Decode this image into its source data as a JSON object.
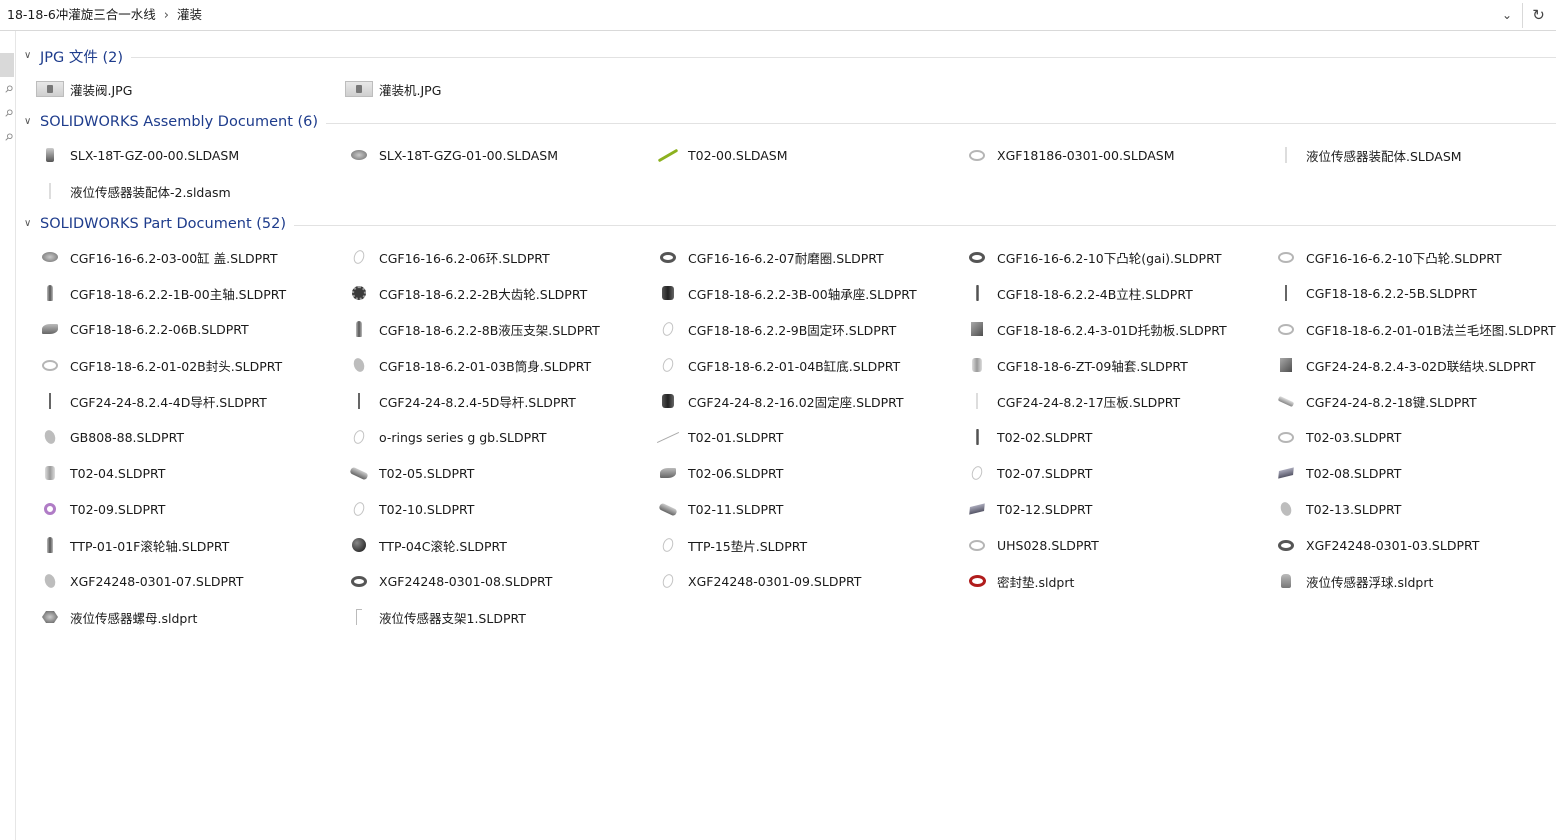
{
  "breadcrumb": [
    "18-18-6冲灌旋三合一水线",
    "灌装"
  ],
  "breadcrumb_separator": "›",
  "address_dropdown_icon": "chevron-down-icon",
  "refresh_icon": "refresh-icon",
  "groups": [
    {
      "title": "JPG 文件 (2)",
      "items": [
        {
          "name": "灌装阀.JPG",
          "icon": "thumb"
        },
        {
          "name": "灌装机.JPG",
          "icon": "thumb"
        }
      ]
    },
    {
      "title": "SOLIDWORKS Assembly Document (6)",
      "items": [
        {
          "name": "SLX-18T-GZ-00-00.SLDASM",
          "icon": "asm"
        },
        {
          "name": "SLX-18T-GZG-01-00.SLDASM",
          "icon": "disc"
        },
        {
          "name": "T02-00.SLDASM",
          "icon": "stick"
        },
        {
          "name": "XGF18186-0301-00.SLDASM",
          "icon": "ring-light"
        },
        {
          "name": "液位传感器装配体.SLDASM",
          "icon": "faint"
        },
        {
          "name": "液位传感器装配体-2.sldasm",
          "icon": "faint"
        }
      ]
    },
    {
      "title": "SOLIDWORKS Part Document (52)",
      "items": [
        {
          "name": "CGF16-16-6.2-03-00缸 盖.SLDPRT",
          "icon": "disc"
        },
        {
          "name": "CGF16-16-6.2-06环.SLDPRT",
          "icon": "ring-thin"
        },
        {
          "name": "CGF16-16-6.2-07耐磨圈.SLDPRT",
          "icon": "ring"
        },
        {
          "name": "CGF16-16-6.2-10下凸轮(gai).SLDPRT",
          "icon": "ring"
        },
        {
          "name": "CGF16-16-6.2-10下凸轮.SLDPRT",
          "icon": "ring-light"
        },
        {
          "name": "CGF18-18-6.2.2-1B-00主轴.SLDPRT",
          "icon": "pin2"
        },
        {
          "name": "CGF18-18-6.2.2-2B大齿轮.SLDPRT",
          "icon": "gear"
        },
        {
          "name": "CGF18-18-6.2.2-3B-00轴承座.SLDPRT",
          "icon": "cyl"
        },
        {
          "name": "CGF18-18-6.2.2-4B立柱.SLDPRT",
          "icon": "rod"
        },
        {
          "name": "CGF18-18-6.2.2-5B.SLDPRT",
          "icon": "rod-thin"
        },
        {
          "name": "CGF18-18-6.2.2-06B.SLDPRT",
          "icon": "mouse"
        },
        {
          "name": "CGF18-18-6.2.2-8B液压支架.SLDPRT",
          "icon": "pin2"
        },
        {
          "name": "CGF18-18-6.2.2-9B固定环.SLDPRT",
          "icon": "ring-thin"
        },
        {
          "name": "CGF18-18-6.2.4-3-01D托勃板.SLDPRT",
          "icon": "block"
        },
        {
          "name": "CGF18-18-6.2-01-01B法兰毛坯图.SLDPRT",
          "icon": "ring-light"
        },
        {
          "name": "CGF18-18-6.2-01-02B封头.SLDPRT",
          "icon": "ring-light"
        },
        {
          "name": "CGF18-18-6.2-01-03B筒身.SLDPRT",
          "icon": "oval"
        },
        {
          "name": "CGF18-18-6.2-01-04B缸底.SLDPRT",
          "icon": "ring-thin"
        },
        {
          "name": "CGF18-18-6-ZT-09轴套.SLDPRT",
          "icon": "cyl-light"
        },
        {
          "name": "CGF24-24-8.2.4-3-02D联结块.SLDPRT",
          "icon": "block"
        },
        {
          "name": "CGF24-24-8.2.4-4D导杆.SLDPRT",
          "icon": "rod-thin"
        },
        {
          "name": "CGF24-24-8.2.4-5D导杆.SLDPRT",
          "icon": "rod-thin"
        },
        {
          "name": "CGF24-24-8.2-16.02固定座.SLDPRT",
          "icon": "cyl"
        },
        {
          "name": "CGF24-24-8.2-17压板.SLDPRT",
          "icon": "faint"
        },
        {
          "name": "CGF24-24-8.2-18键.SLDPRT",
          "icon": "shaft"
        },
        {
          "name": "GB808-88.SLDPRT",
          "icon": "oval"
        },
        {
          "name": "o-rings series g gb.SLDPRT",
          "icon": "ring-thin"
        },
        {
          "name": "T02-01.SLDPRT",
          "icon": "line-diag"
        },
        {
          "name": "T02-02.SLDPRT",
          "icon": "rod"
        },
        {
          "name": "T02-03.SLDPRT",
          "icon": "ring-light"
        },
        {
          "name": "T02-04.SLDPRT",
          "icon": "cyl-light"
        },
        {
          "name": "T02-05.SLDPRT",
          "icon": "roller"
        },
        {
          "name": "T02-06.SLDPRT",
          "icon": "mouse"
        },
        {
          "name": "T02-07.SLDPRT",
          "icon": "ring-thin"
        },
        {
          "name": "T02-08.SLDPRT",
          "icon": "tilt"
        },
        {
          "name": "T02-09.SLDPRT",
          "icon": "purple"
        },
        {
          "name": "T02-10.SLDPRT",
          "icon": "ring-thin"
        },
        {
          "name": "T02-11.SLDPRT",
          "icon": "roller"
        },
        {
          "name": "T02-12.SLDPRT",
          "icon": "tilt"
        },
        {
          "name": "T02-13.SLDPRT",
          "icon": "oval"
        },
        {
          "name": "TTP-01-01F滚轮轴.SLDPRT",
          "icon": "pin2"
        },
        {
          "name": "TTP-04C滚轮.SLDPRT",
          "icon": "ball"
        },
        {
          "name": "TTP-15垫片.SLDPRT",
          "icon": "ring-thin"
        },
        {
          "name": "UHS028.SLDPRT",
          "icon": "ring-light"
        },
        {
          "name": "XGF24248-0301-03.SLDPRT",
          "icon": "ring"
        },
        {
          "name": "XGF24248-0301-07.SLDPRT",
          "icon": "oval"
        },
        {
          "name": "XGF24248-0301-08.SLDPRT",
          "icon": "ring"
        },
        {
          "name": "XGF24248-0301-09.SLDPRT",
          "icon": "ring-thin"
        },
        {
          "name": "密封垫.sldprt",
          "icon": "ring-red"
        },
        {
          "name": "液位传感器浮球.sldprt",
          "icon": "sensor"
        },
        {
          "name": "液位传感器螺母.sldprt",
          "icon": "nut"
        },
        {
          "name": "液位传感器支架1.SLDPRT",
          "icon": "bracket"
        }
      ]
    }
  ]
}
